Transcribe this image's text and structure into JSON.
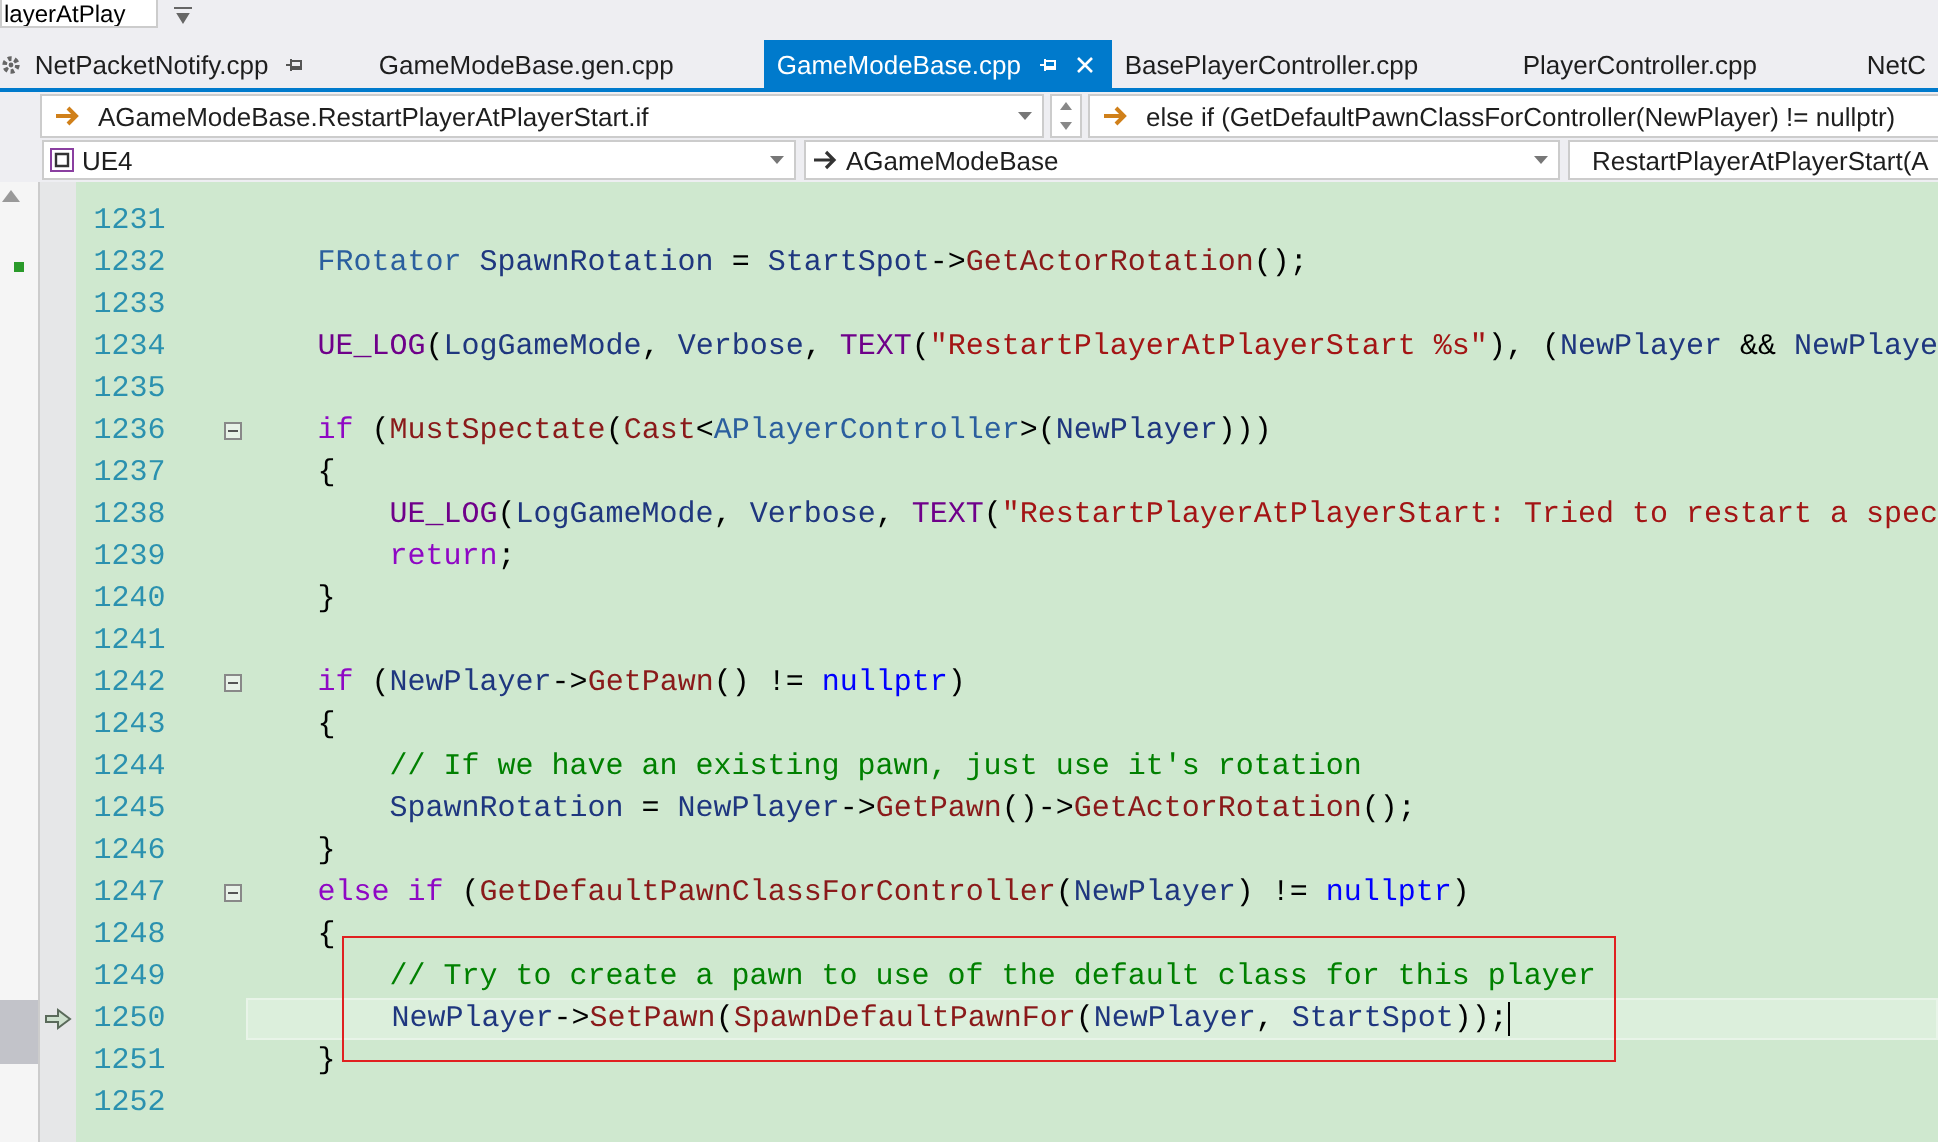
{
  "top_field": {
    "value": "layerAtPlay"
  },
  "tabs": [
    {
      "label": "NetPacketNotify.cpp",
      "selected": false,
      "pinned": true
    },
    {
      "label": "GameModeBase.gen.cpp",
      "selected": false,
      "pinned": false
    },
    {
      "label": "GameModeBase.cpp",
      "selected": true,
      "pinned": true
    },
    {
      "label": "BasePlayerController.cpp",
      "selected": false,
      "pinned": false
    },
    {
      "label": "PlayerController.cpp",
      "selected": false,
      "pinned": false
    },
    {
      "label": "NetC",
      "selected": false,
      "pinned": false
    }
  ],
  "navigation_bar": {
    "scope": "AGameModeBase.RestartPlayerAtPlayerStart.if",
    "statement": "else if (GetDefaultPawnClassForController(NewPlayer) != nullptr)"
  },
  "member_bar": {
    "project": "UE4",
    "class": "AGameModeBase",
    "member": "RestartPlayerAtPlayerStart(A"
  },
  "code_lines": [
    {
      "number": "1231",
      "foldable": false,
      "current": false
    },
    {
      "number": "1232",
      "foldable": false,
      "current": false,
      "tokens": [
        {
          "text": "    FRotator ",
          "kind": "type"
        },
        {
          "text": "SpawnRotation",
          "kind": "id"
        },
        {
          "text": " = ",
          "kind": "plain"
        },
        {
          "text": "StartSpot",
          "kind": "id"
        },
        {
          "text": "->",
          "kind": "plain"
        },
        {
          "text": "GetActorRotation",
          "kind": "fn"
        },
        {
          "text": "();",
          "kind": "plain"
        }
      ]
    },
    {
      "number": "1233",
      "foldable": false,
      "current": false
    },
    {
      "number": "1234",
      "foldable": false,
      "current": false,
      "tokens": [
        {
          "text": "    UE_LOG",
          "kind": "macro"
        },
        {
          "text": "(",
          "kind": "plain"
        },
        {
          "text": "LogGameMode",
          "kind": "id"
        },
        {
          "text": ", ",
          "kind": "plain"
        },
        {
          "text": "Verbose",
          "kind": "id"
        },
        {
          "text": ", ",
          "kind": "plain"
        },
        {
          "text": "TEXT",
          "kind": "macro"
        },
        {
          "text": "(",
          "kind": "plain"
        },
        {
          "text": "\"RestartPlayerAtPlayerStart %s\"",
          "kind": "str"
        },
        {
          "text": "), (",
          "kind": "plain"
        },
        {
          "text": "NewPlayer",
          "kind": "id"
        },
        {
          "text": " && ",
          "kind": "plain"
        },
        {
          "text": "NewPlaye",
          "kind": "id"
        }
      ]
    },
    {
      "number": "1235",
      "foldable": false,
      "current": false
    },
    {
      "number": "1236",
      "foldable": true,
      "current": false,
      "tokens": [
        {
          "text": "    if",
          "kind": "kw"
        },
        {
          "text": " (",
          "kind": "plain"
        },
        {
          "text": "MustSpectate",
          "kind": "fn"
        },
        {
          "text": "(",
          "kind": "plain"
        },
        {
          "text": "Cast",
          "kind": "fn"
        },
        {
          "text": "<",
          "kind": "plain"
        },
        {
          "text": "APlayerController",
          "kind": "type"
        },
        {
          "text": ">(",
          "kind": "plain"
        },
        {
          "text": "NewPlayer",
          "kind": "id"
        },
        {
          "text": ")))",
          "kind": "plain"
        }
      ]
    },
    {
      "number": "1237",
      "foldable": false,
      "current": false,
      "tokens": [
        {
          "text": "    {",
          "kind": "plain"
        }
      ]
    },
    {
      "number": "1238",
      "foldable": false,
      "current": false,
      "tokens": [
        {
          "text": "        UE_LOG",
          "kind": "macro"
        },
        {
          "text": "(",
          "kind": "plain"
        },
        {
          "text": "LogGameMode",
          "kind": "id"
        },
        {
          "text": ", ",
          "kind": "plain"
        },
        {
          "text": "Verbose",
          "kind": "id"
        },
        {
          "text": ", ",
          "kind": "plain"
        },
        {
          "text": "TEXT",
          "kind": "macro"
        },
        {
          "text": "(",
          "kind": "plain"
        },
        {
          "text": "\"RestartPlayerAtPlayerStart: Tried to restart a spec",
          "kind": "str"
        }
      ]
    },
    {
      "number": "1239",
      "foldable": false,
      "current": false,
      "tokens": [
        {
          "text": "        return",
          "kind": "kw"
        },
        {
          "text": ";",
          "kind": "plain"
        }
      ]
    },
    {
      "number": "1240",
      "foldable": false,
      "current": false,
      "tokens": [
        {
          "text": "    }",
          "kind": "plain"
        }
      ]
    },
    {
      "number": "1241",
      "foldable": false,
      "current": false
    },
    {
      "number": "1242",
      "foldable": true,
      "current": false,
      "tokens": [
        {
          "text": "    if",
          "kind": "kw"
        },
        {
          "text": " (",
          "kind": "plain"
        },
        {
          "text": "NewPlayer",
          "kind": "id"
        },
        {
          "text": "->",
          "kind": "plain"
        },
        {
          "text": "GetPawn",
          "kind": "fn"
        },
        {
          "text": "() != ",
          "kind": "plain"
        },
        {
          "text": "nullptr",
          "kind": "lit"
        },
        {
          "text": ")",
          "kind": "plain"
        }
      ]
    },
    {
      "number": "1243",
      "foldable": false,
      "current": false,
      "tokens": [
        {
          "text": "    {",
          "kind": "plain"
        }
      ]
    },
    {
      "number": "1244",
      "foldable": false,
      "current": false,
      "tokens": [
        {
          "text": "        // If we have an existing pawn, just use it's rotation",
          "kind": "comment"
        }
      ]
    },
    {
      "number": "1245",
      "foldable": false,
      "current": false,
      "tokens": [
        {
          "text": "        SpawnRotation",
          "kind": "id"
        },
        {
          "text": " = ",
          "kind": "plain"
        },
        {
          "text": "NewPlayer",
          "kind": "id"
        },
        {
          "text": "->",
          "kind": "plain"
        },
        {
          "text": "GetPawn",
          "kind": "fn"
        },
        {
          "text": "()->",
          "kind": "plain"
        },
        {
          "text": "GetActorRotation",
          "kind": "fn"
        },
        {
          "text": "();",
          "kind": "plain"
        }
      ]
    },
    {
      "number": "1246",
      "foldable": false,
      "current": false,
      "tokens": [
        {
          "text": "    }",
          "kind": "plain"
        }
      ]
    },
    {
      "number": "1247",
      "foldable": true,
      "current": false,
      "tokens": [
        {
          "text": "    else if",
          "kind": "kw"
        },
        {
          "text": " (",
          "kind": "plain"
        },
        {
          "text": "GetDefaultPawnClassForController",
          "kind": "fn"
        },
        {
          "text": "(",
          "kind": "plain"
        },
        {
          "text": "NewPlayer",
          "kind": "id"
        },
        {
          "text": ") != ",
          "kind": "plain"
        },
        {
          "text": "nullptr",
          "kind": "lit"
        },
        {
          "text": ")",
          "kind": "plain"
        }
      ]
    },
    {
      "number": "1248",
      "foldable": false,
      "current": false,
      "tokens": [
        {
          "text": "    {",
          "kind": "plain"
        }
      ]
    },
    {
      "number": "1249",
      "foldable": false,
      "current": false,
      "tokens": [
        {
          "text": "        // Try to create a pawn to use of the default class for this player",
          "kind": "comment"
        }
      ]
    },
    {
      "number": "1250",
      "foldable": false,
      "current": true,
      "tokens": [
        {
          "text": "        NewPlayer",
          "kind": "id"
        },
        {
          "text": "->",
          "kind": "plain"
        },
        {
          "text": "SetPawn",
          "kind": "fn"
        },
        {
          "text": "(",
          "kind": "plain"
        },
        {
          "text": "SpawnDefaultPawnFor",
          "kind": "fn"
        },
        {
          "text": "(",
          "kind": "plain"
        },
        {
          "text": "NewPlayer",
          "kind": "id"
        },
        {
          "text": ", ",
          "kind": "plain"
        },
        {
          "text": "StartSpot",
          "kind": "id"
        },
        {
          "text": "));",
          "kind": "plain"
        }
      ]
    },
    {
      "number": "1251",
      "foldable": false,
      "current": false,
      "tokens": [
        {
          "text": "    }",
          "kind": "plain"
        }
      ]
    },
    {
      "number": "1252",
      "foldable": false,
      "current": false
    }
  ]
}
